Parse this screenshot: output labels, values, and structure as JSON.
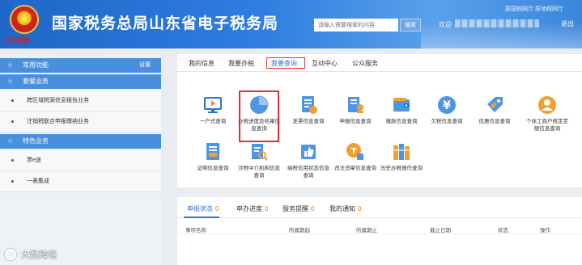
{
  "header": {
    "title": "国家税务总局山东省电子税务局",
    "emblem_text": "山东税务",
    "search_placeholder": "请输入需要搜索的内容",
    "search_button": "搜索",
    "top_links": "原国税网厅 原地税网厅",
    "welcome": "欢迎",
    "logout": "退出",
    "colors": {
      "bar": "#1f66c8",
      "accent": "#2d74d6",
      "highlight": "#e03030"
    }
  },
  "sidebar": {
    "sections": [
      {
        "icon": "star-icon",
        "title": "常用功能",
        "action": "设置"
      },
      {
        "icon": "star-icon",
        "title": "套餐业务"
      },
      {
        "icon": "star-icon",
        "title": "特色业务"
      }
    ],
    "package_items": [
      "跨区域税源信息报告业务",
      "注销税联合申报缴纳业务"
    ],
    "special_items": [
      "票e送",
      "一表集成"
    ]
  },
  "main": {
    "tabs": [
      "我的信息",
      "我要办税",
      "我要查询",
      "互动中心",
      "公众服务"
    ],
    "active_tab": "我要查询",
    "services": [
      {
        "icon": "monitor-icon",
        "label": "一户式查询"
      },
      {
        "icon": "pie-chart-icon",
        "label": "办税进度及结果信息查询"
      },
      {
        "icon": "invoice-icon",
        "label": "发票信息查询"
      },
      {
        "icon": "declaration-icon",
        "label": "申报信息查询"
      },
      {
        "icon": "wallet-icon",
        "label": "缴款信息查询"
      },
      {
        "icon": "yen-coin-icon",
        "label": "欠税信息查询"
      },
      {
        "icon": "tag-icon",
        "label": "优惠信息查询"
      },
      {
        "icon": "person-badge-icon",
        "label": "个体工商户核定定额信息查询"
      },
      {
        "icon": "document-icon",
        "label": "证明信息查询"
      },
      {
        "icon": "magnifier-doc-icon",
        "label": "涉税中介机构信息查询"
      },
      {
        "icon": "thumbs-up-icon",
        "label": "纳税信用状态信息查询"
      },
      {
        "icon": "tax-stamp-icon",
        "label": "违法违章信息查询"
      },
      {
        "icon": "archive-icon",
        "label": "历史办税操作查询"
      }
    ],
    "highlighted_service": "办税进度及结果信息查询"
  },
  "bottom": {
    "tabs": [
      {
        "label": "申报状态",
        "count": "0"
      },
      {
        "label": "申办进度",
        "count": "0"
      },
      {
        "label": "服务提醒",
        "count": "0"
      },
      {
        "label": "我的通知",
        "count": "0"
      }
    ],
    "active_tab": "申报状态",
    "columns": [
      "事项名称",
      "所属期起",
      "所属期止",
      "截止日期",
      "状态",
      "操作"
    ]
  },
  "watermark": "大数跨境"
}
